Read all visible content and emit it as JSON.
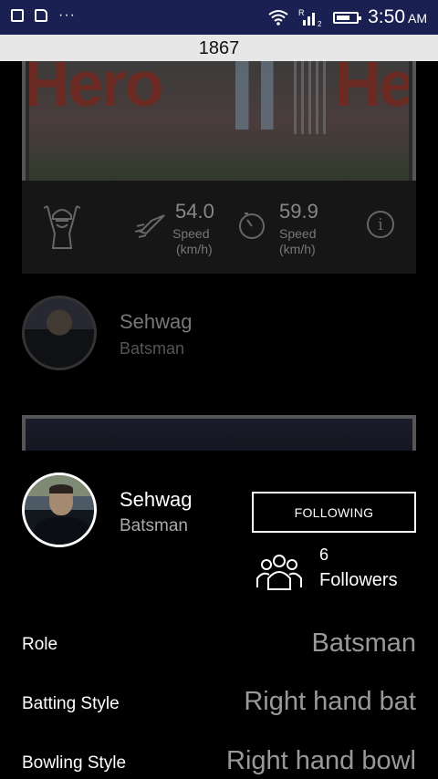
{
  "status_bar": {
    "icons_left": [
      "image-icon",
      "sd-card-icon",
      "more-dots-icon"
    ],
    "more_dots": "···",
    "signal_r": "R",
    "signal_sub": "2",
    "time": "3:50",
    "ampm": "AM"
  },
  "title_bar": {
    "title": "1867"
  },
  "video_card": {
    "hero_text_left": "Hero",
    "hero_text_right": "Hero",
    "stats": {
      "speed1_value": "54.0",
      "speed1_label": "Speed",
      "speed1_unit": "(km/h)",
      "speed2_value": "59.9",
      "speed2_label": "Speed",
      "speed2_unit": "(km/h)",
      "info_glyph": "i"
    }
  },
  "player_row": {
    "name": "Sehwag",
    "role": "Batsman"
  },
  "profile": {
    "name": "Sehwag",
    "role": "Batsman",
    "follow_button": "FOLLOWING",
    "followers_count": "6",
    "followers_label": "Followers"
  },
  "details": [
    {
      "label": "Role",
      "value": "Batsman"
    },
    {
      "label": "Batting Style",
      "value": "Right hand bat"
    },
    {
      "label": "Bowling Style",
      "value": "Right hand bowl"
    }
  ]
}
